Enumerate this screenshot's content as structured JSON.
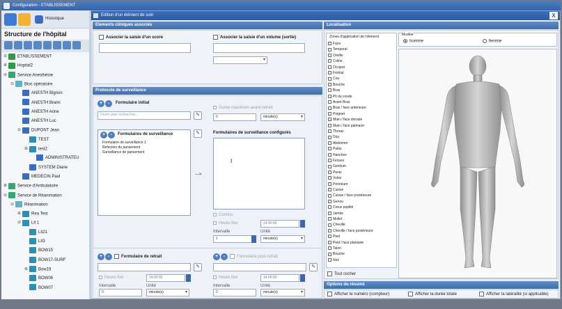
{
  "app": {
    "title": "Configuration - ETABLISSEMENT"
  },
  "toolbar": {
    "history_label": "Historique"
  },
  "structure": {
    "title": "Structure de l'hôpital",
    "tree": [
      {
        "label": "ETABLISSEMENT",
        "depth": 0,
        "color": "#2e9a44",
        "expander": "⊖"
      },
      {
        "label": "Hopital2",
        "depth": 0,
        "color": "#2e9a44",
        "expander": "⊕"
      },
      {
        "label": "Service Anesthésie",
        "depth": 0,
        "color": "#34a873",
        "expander": "⊖"
      },
      {
        "label": "Bloc opératoire",
        "depth": 1,
        "color": "#5fb3c9",
        "expander": "⊖"
      },
      {
        "label": "ANESTH Bignon",
        "depth": 2,
        "color": "#3a6cc0",
        "expander": ""
      },
      {
        "label": "ANESTH Brami",
        "depth": 2,
        "color": "#3a6cc0",
        "expander": ""
      },
      {
        "label": "ANESTH Anne",
        "depth": 2,
        "color": "#3a6cc0",
        "expander": ""
      },
      {
        "label": "ANESTH Luc",
        "depth": 2,
        "color": "#3a6cc0",
        "expander": ""
      },
      {
        "label": "DUPONT Jean",
        "depth": 2,
        "color": "#3a6cc0",
        "expander": "⊖"
      },
      {
        "label": "TEST",
        "depth": 3,
        "color": "#2e8fb0",
        "expander": ""
      },
      {
        "label": "test2",
        "depth": 3,
        "color": "#2e8fb0",
        "expander": "⊕"
      },
      {
        "label": "ADMINISTRATEU",
        "depth": 4,
        "color": "#3a6cc0",
        "expander": ""
      },
      {
        "label": "SYSTEM Diane",
        "depth": 3,
        "color": "#3a6cc0",
        "expander": ""
      },
      {
        "label": "MEDECIN Paul",
        "depth": 2,
        "color": "#3a6cc0",
        "expander": ""
      },
      {
        "label": "Service d'Ambulatoire",
        "depth": 0,
        "color": "#34a873",
        "expander": "⊕"
      },
      {
        "label": "Service de Réanimation",
        "depth": 0,
        "color": "#34a873",
        "expander": "⊖"
      },
      {
        "label": "Réanimation",
        "depth": 1,
        "color": "#5fb3c9",
        "expander": "⊖"
      },
      {
        "label": "Rea Test",
        "depth": 2,
        "color": "#2e8fb0",
        "expander": "⊕"
      },
      {
        "label": "Lit 1",
        "depth": 2,
        "color": "#2e8fb0",
        "expander": "⊖"
      },
      {
        "label": "Lit21",
        "depth": 3,
        "color": "#2e8fb0",
        "expander": ""
      },
      {
        "label": "Lit3",
        "depth": 3,
        "color": "#2e8fb0",
        "expander": ""
      },
      {
        "label": "BOW15",
        "depth": 3,
        "color": "#2e8fb0",
        "expander": ""
      },
      {
        "label": "BOW17-SURF",
        "depth": 3,
        "color": "#2e8fb0",
        "expander": ""
      },
      {
        "label": "Bow19",
        "depth": 3,
        "color": "#2e8fb0",
        "expander": "⊕"
      },
      {
        "label": "BOW06",
        "depth": 3,
        "color": "#2e8fb0",
        "expander": ""
      },
      {
        "label": "BOW07",
        "depth": 3,
        "color": "#2e8fb0",
        "expander": ""
      }
    ]
  },
  "dialog": {
    "title": "Edition d'un élément de soin",
    "close_label": "X",
    "clinical": {
      "header": "Elements cliniques associés",
      "score_label": "Associer la saisie d'un score",
      "volume_label": "Associer la saisie d'un volume (sortie)"
    },
    "protocol": {
      "header": "Protocole de surveillance",
      "initial_form_label": "Formulaire initial",
      "initial_search_placeholder": "Ouvrir pour rechercher...",
      "max_delay_label": "Durée maximum avant retrait",
      "max_delay_value": "0",
      "max_delay_unit": "minute(s)",
      "forms_label": "Formulaires de surveillance",
      "forms_list": [
        "Formulaire de surveillance 1",
        "Refection du pansement",
        "Surveillance de pansement"
      ],
      "arrow_label": "--->",
      "configured_label": "Formulaires de surveillance configurés",
      "cursor_glyph": "I",
      "continu_label": "Continu",
      "fixed_hour_label": "Heure fixe",
      "fixed_hour_value": "14:00:00",
      "interval_label": "Intervalle",
      "interval_value": "1",
      "unit_label": "Unité",
      "unit_value": "minute(s)",
      "removal_form_label": "Formulaire de retrait",
      "removal_fixed_hour_label": "Heure fixe",
      "removal_fixed_hour_value": "14:00:00",
      "removal_interval_label": "Intervalle",
      "removal_interval_value": "0",
      "removal_unit_label": "Unité",
      "removal_unit_value": "minute(s)",
      "post_removal_label": "Formulaire post-retrait",
      "post_fixed_hour_label": "Heure fixe",
      "post_fixed_hour_value": "14:00:00",
      "post_interval_label": "Intervalle",
      "post_interval_value": "0",
      "post_unit_label": "Unité",
      "post_unit_value": "minute(s)"
    },
    "localisation": {
      "header": "Localisation",
      "zones_label": "Zones d'application de l'élément",
      "zones": [
        "Face",
        "Temporal",
        "Oreille",
        "Crâne",
        "Occiput",
        "Frontal",
        "Cou",
        "Bouche",
        "Bras",
        "Pli du coude",
        "Avant Bras",
        "Bras / face antérieure",
        "Poignet",
        "Main / face dorsale",
        "Main / face palmaire",
        "Thorax",
        "Dos",
        "Abdomen",
        "Pubis",
        "Hanches",
        "Fesses",
        "Genitum",
        "Penis",
        "Vulve",
        "Périnéum",
        "Cuisse",
        "Cuisse / face postérieure",
        "Genou",
        "Creux poplité",
        "Jambe",
        "Mollet",
        "Cheville",
        "Cheville / face postérieure",
        "Pied",
        "Pied / face plantaire",
        "Talon",
        "Bouche",
        "Nez"
      ],
      "check_all_label": "Tout cocher",
      "model_label": "Modèle",
      "model_options": [
        "homme",
        "femme"
      ]
    },
    "summary": {
      "header": "Options du résumé",
      "show_number_label": "Afficher le numéro (compteur)",
      "show_duration_label": "Afficher la durée totale",
      "show_laterality_label": "Afficher la latéralité (si applicable)"
    }
  },
  "colors": {
    "accent": "#3f6fae",
    "title_bar": "#2c5aa0",
    "skin": "#b8b8b8"
  }
}
